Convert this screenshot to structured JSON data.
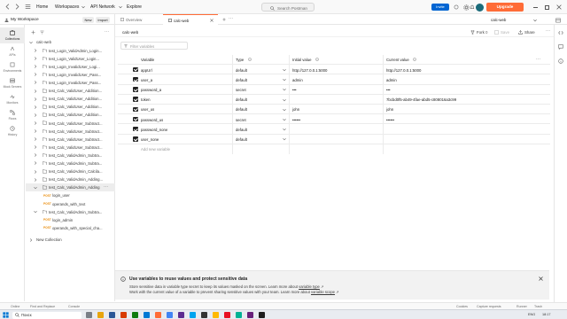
{
  "topbar": {
    "nav": [
      "Home",
      "Workspaces",
      "API Network",
      "Explore"
    ],
    "search_placeholder": "Search Postman",
    "invite_label": "Invite",
    "upgrade_label": "Upgrade"
  },
  "workspace": {
    "name": "My Workspace",
    "new_label": "New",
    "import_label": "Import"
  },
  "rail": [
    "Collections",
    "APIs",
    "Environments",
    "Mock Servers",
    "Monitors",
    "Flows",
    "History"
  ],
  "tabs": {
    "overview": "Overview",
    "active": "calc-web",
    "env_selector": "calc-web"
  },
  "tree": {
    "root": "calc-web",
    "items": [
      "test_Login_ValidAdmin_Login...",
      "test_Login_ValidUser_Login...",
      "test_Login_InvalidUser_Logi...",
      "test_Login_InvalidUser_Pass...",
      "test_Login_InvalidUser_Pass...",
      "test_Calc_ValidUser_Addition...",
      "test_Calc_ValidUser_Addition...",
      "test_Calc_ValidUser_Addition...",
      "test_Calc_ValidUser_Addition...",
      "test_Calc_ValidUser_Subtract...",
      "test_Calc_ValidUser_Subtract...",
      "test_Calc_ValidUser_Subtract...",
      "test_Calc_ValidUser_Subtract...",
      "test_Calc_ValidAdmin_Subtra...",
      "test_Calc_ValidAdmin_Subtra...",
      "test_Calc_ValidAdmin_Calcila...",
      "test_Calc_ValidAdmin_Adding..."
    ],
    "open_item_1": "test_Calc_ValidAdmin_Adding...",
    "sub_items_1": [
      {
        "method": "POST",
        "name": "login_user"
      },
      {
        "method": "POST",
        "name": "operands_with_text"
      }
    ],
    "open_item_2": "test_Calc_ValidAdmin_Subtra...",
    "sub_items_2": [
      {
        "method": "POST",
        "name": "login_admin"
      },
      {
        "method": "POST",
        "name": "operands_with_special_cha..."
      }
    ],
    "new_collection": "New Collection"
  },
  "env": {
    "title": "calc-web",
    "fork_label": "Fork",
    "fork_count": "0",
    "save_label": "Save",
    "share_label": "Share",
    "filter_placeholder": "Filter variables"
  },
  "table": {
    "headers": [
      "Variable",
      "Type",
      "Initial value",
      "Current value"
    ],
    "rows": [
      {
        "variable": "appUrl",
        "type": "default",
        "initial": "http://127.0.0.1:5000",
        "current": "http://127.0.0.1:5000"
      },
      {
        "variable": "user_a",
        "type": "default",
        "initial": "admin",
        "current": "admin"
      },
      {
        "variable": "password_a",
        "type": "secret",
        "initial": "•••",
        "current": "•••"
      },
      {
        "variable": "token",
        "type": "default",
        "initial": "",
        "current": "7bcbd0f5-ab49-4fae-abd5-c808016a3c99"
      },
      {
        "variable": "user_us",
        "type": "default",
        "initial": "john",
        "current": "john"
      },
      {
        "variable": "password_us",
        "type": "secret",
        "initial": "••••••",
        "current": "••••••"
      },
      {
        "variable": "password_none",
        "type": "default",
        "initial": "",
        "current": ""
      },
      {
        "variable": "user_none",
        "type": "default",
        "initial": "",
        "current": ""
      }
    ],
    "add_placeholder": "Add new variable"
  },
  "banner": {
    "title": "Use variables to reuse values and protect sensitive data",
    "line1": "Store sensitive data in variable type secret to keep its values masked on the screen. Learn more about",
    "link1": "variable type",
    "line2": "Work with the current value of a variable to prevent sharing sensitive values with your team. Learn more about",
    "link2": "variable scope"
  },
  "statusbar": {
    "online": "Online",
    "find": "Find and Replace",
    "console": "Console",
    "cookies": "Cookies",
    "capture": "Capture requests",
    "runner": "Runner",
    "trash": "Trash"
  },
  "taskbar": {
    "search": "Поиск",
    "lang": "ENG",
    "time": "18:17"
  }
}
